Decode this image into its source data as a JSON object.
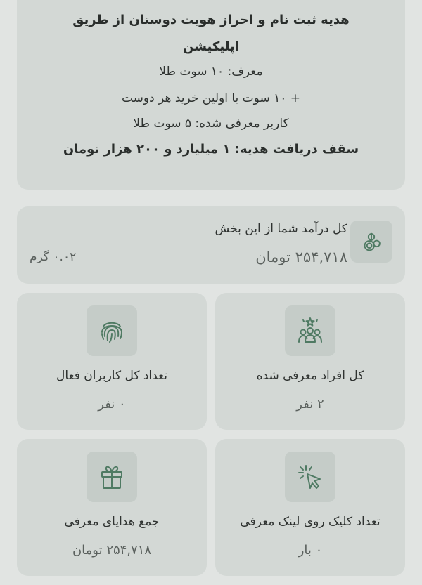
{
  "info": {
    "title_line1": "هدیه ثبت نام و احراز هویت دوستان از طریق",
    "title_line2": "اپلیکیشن",
    "referrer_gift": "معرف: ۱۰ سوت طلا",
    "per_purchase_gift": "+ ۱۰ سوت با اولین خرید هر دوست",
    "referred_user_gift": "کاربر معرفی شده: ۵ سوت طلا",
    "gift_cap": "سقف دریافت هدیه: ۱ میلیارد و ۲۰۰ هزار تومان"
  },
  "income": {
    "label": "کل درآمد شما از این بخش",
    "value": "۲۵۴,۷۱۸ تومان",
    "gram": "۰.۰۲ گرم",
    "icon": "coins-leaf-icon"
  },
  "stats": {
    "referred_total": {
      "label": "کل افراد معرفی شده",
      "value": "۲ نفر",
      "icon": "people-star-icon"
    },
    "active_users": {
      "label": "تعداد کل کاربران فعال",
      "value": "۰ نفر",
      "icon": "fingerprint-icon"
    },
    "link_clicks": {
      "label": "تعداد کلیک روی لینک معرفی",
      "value": "۰ بار",
      "icon": "cursor-click-icon"
    },
    "gifts_total": {
      "label": "جمع هدایای معرفی",
      "value": "۲۵۴,۷۱۸ تومان",
      "icon": "gift-icon"
    }
  },
  "colors": {
    "background": "#e1e4e2",
    "card": "#d3d8d5",
    "icon_box": "#c5ccc8",
    "icon_stroke": "#4f7a63"
  }
}
